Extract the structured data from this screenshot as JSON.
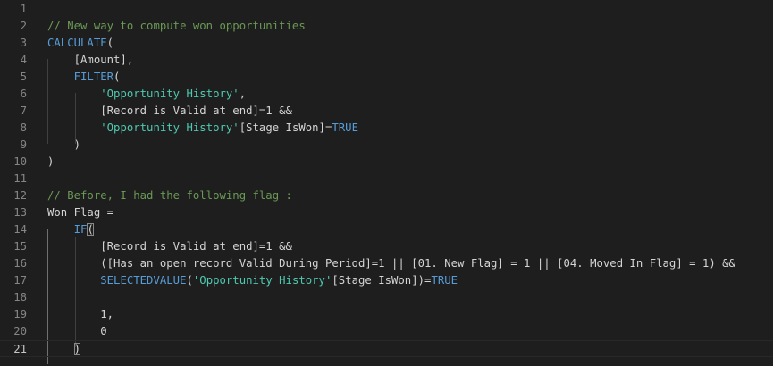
{
  "editor": {
    "lines": [
      {
        "number": "1",
        "tokens": []
      },
      {
        "number": "2",
        "tokens": [
          {
            "text": "// New way to compute won opportunities",
            "kind": "comment"
          }
        ]
      },
      {
        "number": "3",
        "tokens": [
          {
            "text": "CALCULATE",
            "kind": "func"
          },
          {
            "text": "(",
            "kind": "text"
          }
        ]
      },
      {
        "number": "4",
        "tokens": [
          {
            "text": "    [Amount],",
            "kind": "text"
          }
        ]
      },
      {
        "number": "5",
        "tokens": [
          {
            "text": "    ",
            "kind": "text"
          },
          {
            "text": "FILTER",
            "kind": "func"
          },
          {
            "text": "(",
            "kind": "text"
          }
        ]
      },
      {
        "number": "6",
        "tokens": [
          {
            "text": "        ",
            "kind": "text"
          },
          {
            "text": "'Opportunity History'",
            "kind": "table"
          },
          {
            "text": ",",
            "kind": "text"
          }
        ]
      },
      {
        "number": "7",
        "tokens": [
          {
            "text": "        [Record is Valid at end]=1 &&",
            "kind": "text"
          }
        ]
      },
      {
        "number": "8",
        "tokens": [
          {
            "text": "        ",
            "kind": "text"
          },
          {
            "text": "'Opportunity History'",
            "kind": "table"
          },
          {
            "text": "[Stage IsWon]=",
            "kind": "text"
          },
          {
            "text": "TRUE",
            "kind": "func"
          }
        ]
      },
      {
        "number": "9",
        "tokens": [
          {
            "text": "    )",
            "kind": "text"
          }
        ]
      },
      {
        "number": "10",
        "tokens": [
          {
            "text": ")",
            "kind": "text"
          }
        ]
      },
      {
        "number": "11",
        "tokens": []
      },
      {
        "number": "12",
        "tokens": [
          {
            "text": "// Before, I had the following flag :",
            "kind": "comment"
          }
        ]
      },
      {
        "number": "13",
        "tokens": [
          {
            "text": "Won Flag =",
            "kind": "text"
          }
        ]
      },
      {
        "number": "14",
        "tokens": [
          {
            "text": "    ",
            "kind": "text"
          },
          {
            "text": "IF",
            "kind": "func"
          },
          {
            "text": "(",
            "kind": "bracket"
          }
        ]
      },
      {
        "number": "15",
        "tokens": [
          {
            "text": "        [Record is Valid at end]=1 &&",
            "kind": "text"
          }
        ]
      },
      {
        "number": "16",
        "tokens": [
          {
            "text": "        ([Has an open record Valid During Period]=1 || [01. New Flag] = 1 || [04. Moved In Flag] = 1) &&",
            "kind": "text"
          }
        ]
      },
      {
        "number": "17",
        "tokens": [
          {
            "text": "        ",
            "kind": "text"
          },
          {
            "text": "SELECTEDVALUE",
            "kind": "func"
          },
          {
            "text": "(",
            "kind": "text"
          },
          {
            "text": "'Opportunity History'",
            "kind": "table"
          },
          {
            "text": "[Stage IsWon])=",
            "kind": "text"
          },
          {
            "text": "TRUE",
            "kind": "func"
          }
        ]
      },
      {
        "number": "18",
        "tokens": []
      },
      {
        "number": "19",
        "tokens": [
          {
            "text": "        1,",
            "kind": "text"
          }
        ]
      },
      {
        "number": "20",
        "tokens": [
          {
            "text": "        0",
            "kind": "text"
          }
        ]
      },
      {
        "number": "21",
        "tokens": [
          {
            "text": "    ",
            "kind": "text"
          },
          {
            "text": ")",
            "kind": "bracket"
          }
        ]
      }
    ],
    "current_line": "21",
    "colors": {
      "background": "#1e1e1e",
      "comment": "#6a9955",
      "func": "#569cd6",
      "table": "#4ec9b0",
      "text": "#d4d4d4",
      "line_number": "#858585"
    }
  }
}
